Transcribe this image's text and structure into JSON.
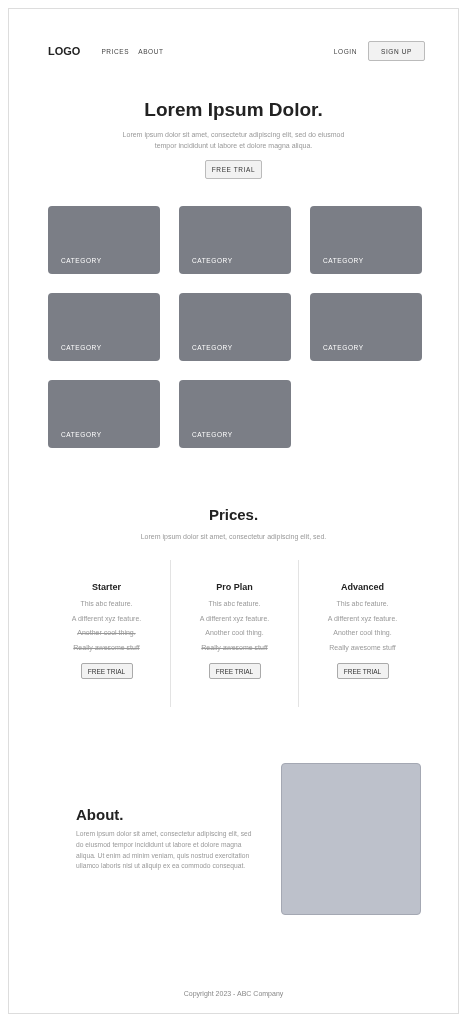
{
  "nav": {
    "logo": "LOGO",
    "links": [
      "PRICES",
      "ABOUT"
    ],
    "login": "LOGIN",
    "signup": "SIGN UP"
  },
  "hero": {
    "title": "Lorem Ipsum Dolor.",
    "text": "Lorem ipsum dolor sit amet, consectetur adipiscing elit, sed do eiusmod tempor incididunt ut labore et dolore magna aliqua.",
    "button": "FREE TRIAL"
  },
  "categories": [
    {
      "label": "CATEGORY"
    },
    {
      "label": "CATEGORY"
    },
    {
      "label": "CATEGORY"
    },
    {
      "label": "CATEGORY"
    },
    {
      "label": "CATEGORY"
    },
    {
      "label": "CATEGORY"
    },
    {
      "label": "CATEGORY"
    },
    {
      "label": "CATEGORY"
    }
  ],
  "prices": {
    "title": "Prices.",
    "text": "Lorem ipsum dolor sit amet, consectetur adipiscing elit, sed.",
    "plans": [
      {
        "name": "Starter",
        "features": [
          {
            "text": "This abc feature.",
            "included": true
          },
          {
            "text": "A different xyz feature.",
            "included": true
          },
          {
            "text": "Another cool thing.",
            "included": false
          },
          {
            "text": "Really awesome stuff",
            "included": false
          }
        ],
        "button": "FREE TRIAL"
      },
      {
        "name": "Pro Plan",
        "features": [
          {
            "text": "This abc feature.",
            "included": true
          },
          {
            "text": "A different xyz feature.",
            "included": true
          },
          {
            "text": "Another cool thing.",
            "included": true
          },
          {
            "text": "Really awesome stuff",
            "included": false
          }
        ],
        "button": "FREE TRIAL"
      },
      {
        "name": "Advanced",
        "features": [
          {
            "text": "This abc feature.",
            "included": true
          },
          {
            "text": "A different xyz feature.",
            "included": true
          },
          {
            "text": "Another cool thing.",
            "included": true
          },
          {
            "text": "Really awesome stuff",
            "included": true
          }
        ],
        "button": "FREE TRIAL"
      }
    ]
  },
  "about": {
    "title": "About.",
    "text": "Lorem ipsum dolor sit amet, consectetur adipiscing elit, sed do eiusmod tempor incididunt ut labore et dolore magna aliqua. Ut enim ad minim veniam, quis nostrud exercitation ullamco laboris nisi ut aliquip ex ea commodo consequat."
  },
  "footer": "Copyright 2023 - ABC Company"
}
